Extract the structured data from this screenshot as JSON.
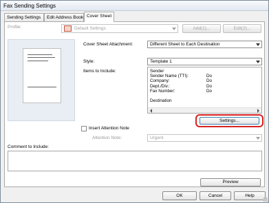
{
  "window": {
    "title": "Fax Sending Settings"
  },
  "tabs": [
    {
      "label": "Sending Settings"
    },
    {
      "label": "Edit Address Book"
    },
    {
      "label": "Cover Sheet"
    }
  ],
  "profile": {
    "label": "Profile:",
    "value": "Default Settings",
    "add_label": "Add(1)...",
    "edit_label": "Edit(2)..."
  },
  "cover_sheet_attachment": {
    "label": "Cover Sheet Attachment:",
    "value": "Different Sheet to Each Destination"
  },
  "style": {
    "label": "Style:",
    "value": "Template 1"
  },
  "items_to_include": {
    "label": "Items to Include:",
    "items": [
      {
        "name": "Sender",
        "value": ""
      },
      {
        "name": "Sender Name (TTI):",
        "value": "Do"
      },
      {
        "name": "Company:",
        "value": "Do"
      },
      {
        "name": "Dept./Div.:",
        "value": "Do"
      },
      {
        "name": "Fax Number:",
        "value": "Do"
      },
      {
        "name": "",
        "value": ""
      },
      {
        "name": "Destination",
        "value": ""
      }
    ]
  },
  "settings_button": {
    "label": "Settings..."
  },
  "attention": {
    "checkbox_label": "Insert Attention Note",
    "note_label": "Attention Note:",
    "note_value": "Urgent"
  },
  "comment": {
    "label": "Comment to Include:"
  },
  "preview_button": {
    "label": "Preview"
  },
  "footer": {
    "ok": "OK",
    "cancel": "Cancel",
    "help": "Help"
  },
  "colors": {
    "highlight_ring": "#d82020"
  }
}
